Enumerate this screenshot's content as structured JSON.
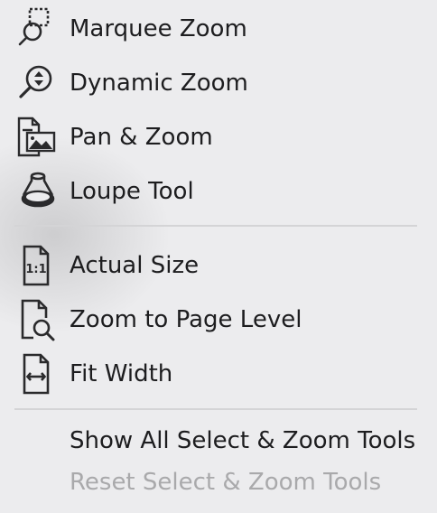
{
  "menu": {
    "items": [
      {
        "label": "Marquee Zoom",
        "icon": "marquee-zoom-icon"
      },
      {
        "label": "Dynamic Zoom",
        "icon": "dynamic-zoom-icon"
      },
      {
        "label": "Pan & Zoom",
        "icon": "pan-zoom-icon"
      },
      {
        "label": "Loupe Tool",
        "icon": "loupe-tool-icon"
      },
      {
        "label": "Actual Size",
        "icon": "actual-size-icon"
      },
      {
        "label": "Zoom to Page Level",
        "icon": "zoom-page-level-icon"
      },
      {
        "label": "Fit Width",
        "icon": "fit-width-icon"
      }
    ],
    "show_all": "Show All Select & Zoom Tools",
    "reset": "Reset Select & Zoom Tools"
  },
  "colors": {
    "background": "#ececee",
    "text": "#1d1d1f",
    "disabled_text": "#a9a9ab",
    "separator": "#d4d4d6"
  }
}
